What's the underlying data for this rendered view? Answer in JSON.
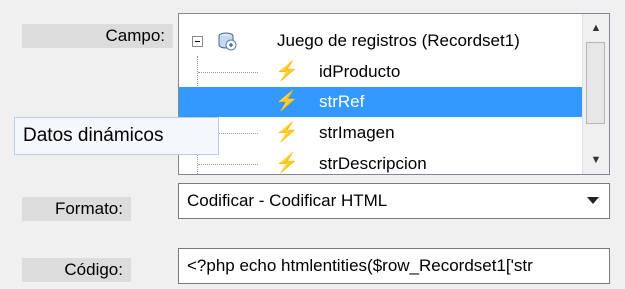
{
  "labels": {
    "campo": "Campo:",
    "formato": "Formato:",
    "codigo": "Código:"
  },
  "tree": {
    "root": {
      "label": "Juego de registros (Recordset1)",
      "icon": "database-icon",
      "expander": "−"
    },
    "items": [
      {
        "label": "idProducto",
        "icon": "lightning-icon",
        "selected": false
      },
      {
        "label": "strRef",
        "icon": "lightning-icon",
        "selected": true
      },
      {
        "label": "strImagen",
        "icon": "lightning-icon",
        "selected": false
      },
      {
        "label": "strDescripcion",
        "icon": "lightning-icon",
        "selected": false
      }
    ]
  },
  "tooltip": {
    "text": "Datos dinámicos"
  },
  "formato": {
    "value": "Codificar - Codificar HTML"
  },
  "codigo": {
    "value": "<?php echo htmlentities($row_Recordset1['str"
  },
  "colors": {
    "selection": "#3399ff",
    "bolt": "#f0b400",
    "label_bg": "#dcdcdc"
  }
}
